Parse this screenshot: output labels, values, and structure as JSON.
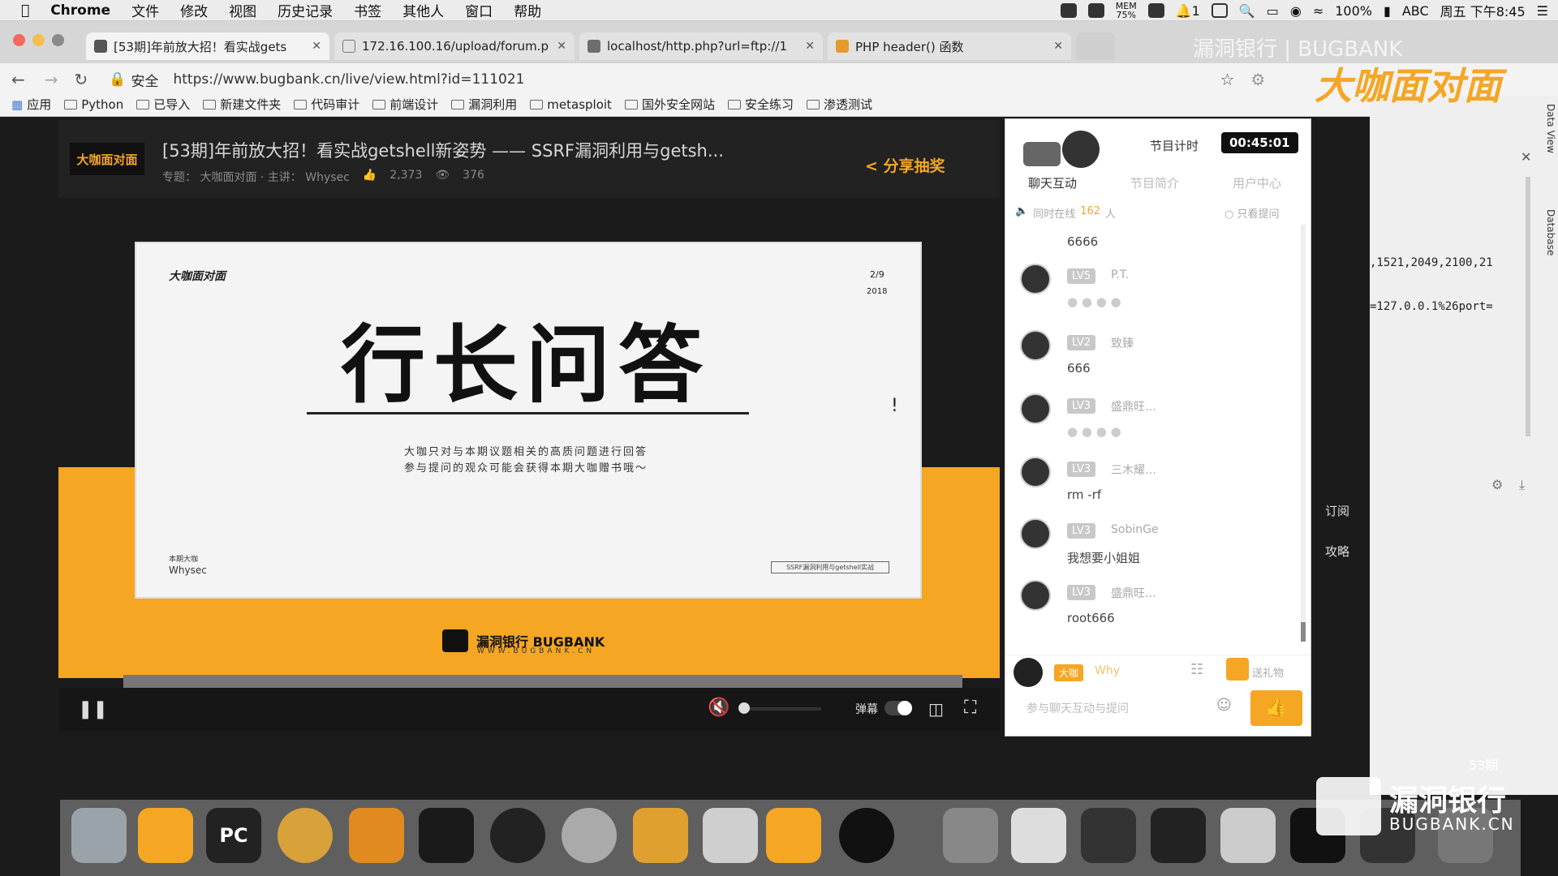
{
  "menubar": {
    "app": "Chrome",
    "items": [
      "文件",
      "修改",
      "视图",
      "历史记录",
      "书签",
      "其他人",
      "窗口",
      "帮助"
    ],
    "status": {
      "mem": "MEM",
      "mem_pct": "75%",
      "battery": "100%",
      "input": "ABC",
      "clock": "周五 下午8:45",
      "badge": "1"
    }
  },
  "tabs": [
    {
      "title": "[53期]年前放大招！看实战gets"
    },
    {
      "title": "172.16.100.16/upload/forum.p"
    },
    {
      "title": "localhost/http.php?url=ftp://1"
    },
    {
      "title": "PHP header() 函数"
    }
  ],
  "address": {
    "secure": "安全",
    "url": "https://www.bugbank.cn/live/view.html?id=111021"
  },
  "bookmarks": [
    "应用",
    "Python",
    "已导入",
    "新建文件夹",
    "代码审计",
    "前端设计",
    "漏洞利用",
    "metasploit",
    "国外安全网站",
    "安全练习",
    "渗透测试"
  ],
  "watermark": {
    "top": "漏洞银行 | BUGBANK",
    "show": "大咖面对面",
    "bottom": "漏洞银行",
    "bottom_en": "BUGBANK.CN",
    "episode": "53期"
  },
  "live": {
    "logo": "大咖面对面",
    "title": "[53期]年前放大招！看实战getshell新姿势 —— SSRF漏洞利用与getsh...",
    "topic": "专题： 大咖面对面 · 主讲： Whysec",
    "likes": "2,373",
    "views": "376",
    "share": "分享抽奖"
  },
  "slide": {
    "brand": "大咖面对面",
    "date_top": "2/9",
    "date_year": "2018",
    "headline": "行长问答",
    "desc1": "大咖只对与本期议题相关的高质问题进行回答",
    "desc2": "参与提问的观众可能会获得本期大咖赠书哦～",
    "guest_label": "本期大咖",
    "guest": "Whysec",
    "footer_note": "SSRF漏洞利用与getshell实战",
    "footer_brand": "漏洞银行  BUGBANK",
    "footer_url": "WWW.BUGBANK.CN"
  },
  "controls": {
    "danmu": "弹幕"
  },
  "chat": {
    "timer_label": "节目计时",
    "timer": "00:45:01",
    "tabs": [
      "聊天互动",
      "节目简介",
      "用户中心"
    ],
    "online": "同时在线",
    "online_count": "162",
    "online_unit": "人",
    "only_ask": "只看提问",
    "messages": [
      {
        "lv": "",
        "name": "",
        "text": "6666"
      },
      {
        "lv": "LV5",
        "name": "P.T.",
        "text": ""
      },
      {
        "lv": "LV2",
        "name": "致臻",
        "text": "666"
      },
      {
        "lv": "LV3",
        "name": "盛鼎旺…",
        "text": ""
      },
      {
        "lv": "LV3",
        "name": "三木耀…",
        "text": "rm -rf"
      },
      {
        "lv": "LV3",
        "name": "SobinGe",
        "text": "我想要小姐姐"
      },
      {
        "lv": "LV3",
        "name": "盛鼎旺…",
        "text": "root666"
      }
    ],
    "self_badge": "大咖",
    "self_name": "Why",
    "gift": "送礼物",
    "input_placeholder": "参与聊天互动与提问",
    "side_subscribe": "订阅",
    "side_guide": "攻略"
  },
  "right": {
    "data_view": "Data View",
    "database": "Database",
    "ports": ",1521,2049,2100,21",
    "payload": "=127.0.0.1%26port="
  }
}
